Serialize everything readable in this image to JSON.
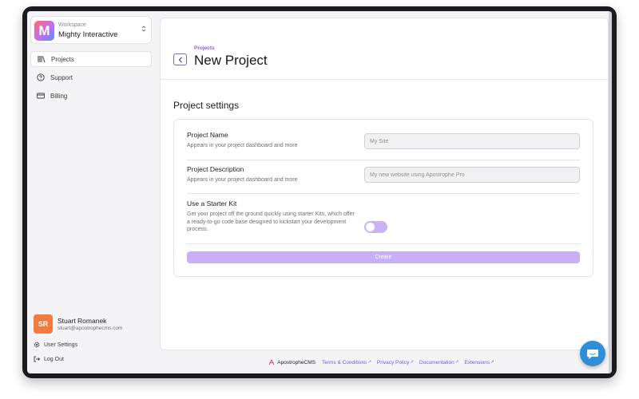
{
  "workspace": {
    "caption": "Workspace",
    "name": "Mighty Interactive",
    "logo_letter": "M"
  },
  "nav": [
    {
      "label": "Projects",
      "icon": "library-icon",
      "active": true
    },
    {
      "label": "Support",
      "icon": "help-icon",
      "active": false
    },
    {
      "label": "Billing",
      "icon": "credit-card-icon",
      "active": false
    }
  ],
  "user": {
    "initials": "SR",
    "name": "Stuart Romanek",
    "email": "stuart@apostrophecms.com"
  },
  "bottom_links": {
    "settings": "User Settings",
    "logout": "Log Out"
  },
  "header": {
    "breadcrumb": "Projects",
    "title": "New Project"
  },
  "section_title": "Project settings",
  "form": {
    "name": {
      "label": "Project Name",
      "help": "Appears in your project dashboard and more",
      "placeholder": "My Site"
    },
    "description": {
      "label": "Project Description",
      "help": "Appears in your project dashboard and more",
      "placeholder": "My new website using Apostrophe Pro"
    },
    "starter_kit": {
      "label": "Use a Starter Kit",
      "help": "Get your project off the ground quickly using starter Kits, which offer a ready-to-go code base designed to kickstart your development process.",
      "enabled": false
    },
    "create_label": "Create"
  },
  "footer": {
    "brand": "ApostropheCMS",
    "links": [
      "Terms & Conditions",
      "Privacy Policy",
      "Documentation",
      "Extensions"
    ]
  },
  "colors": {
    "accent": "#8b5cf6",
    "button_disabled": "#c7b0f7",
    "chat": "#2e8ed8",
    "avatar": "#f07a3f"
  }
}
